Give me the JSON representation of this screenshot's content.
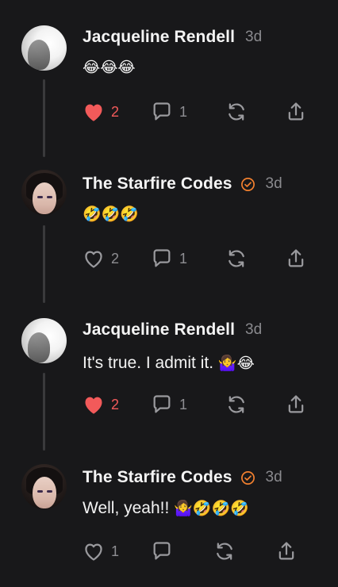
{
  "posts": [
    {
      "author": "Jacqueline Rendell",
      "verified": false,
      "time": "3d",
      "text": "",
      "emoji": "😂😂😂",
      "liked": true,
      "likes": "2",
      "replies": "1",
      "avatar": "jacqueline-rendell"
    },
    {
      "author": "The Starfire Codes",
      "verified": true,
      "time": "3d",
      "text": "",
      "emoji": "🤣🤣🤣",
      "liked": false,
      "likes": "2",
      "replies": "1",
      "avatar": "starfire-codes"
    },
    {
      "author": "Jacqueline Rendell",
      "verified": false,
      "time": "3d",
      "text": "It's true. I admit it.",
      "emoji": "🤷‍♀️😂",
      "liked": true,
      "likes": "2",
      "replies": "1",
      "avatar": "jacqueline-rendell"
    },
    {
      "author": "The Starfire Codes",
      "verified": true,
      "time": "3d",
      "text": "Well, yeah!!",
      "emoji": "🤷‍♀️🤣🤣🤣",
      "liked": false,
      "likes": "1",
      "replies": "",
      "avatar": "starfire-codes"
    }
  ],
  "icons": {
    "like": "heart-icon",
    "reply": "comment-bubble-icon",
    "repost": "repost-icon",
    "share": "share-icon",
    "verified": "verified-badge-icon"
  },
  "colors": {
    "background": "#18181a",
    "liked": "#f25a5a",
    "verified": "#f2802f",
    "muted": "#8e8e92",
    "thread_line": "#3a3a3c"
  }
}
